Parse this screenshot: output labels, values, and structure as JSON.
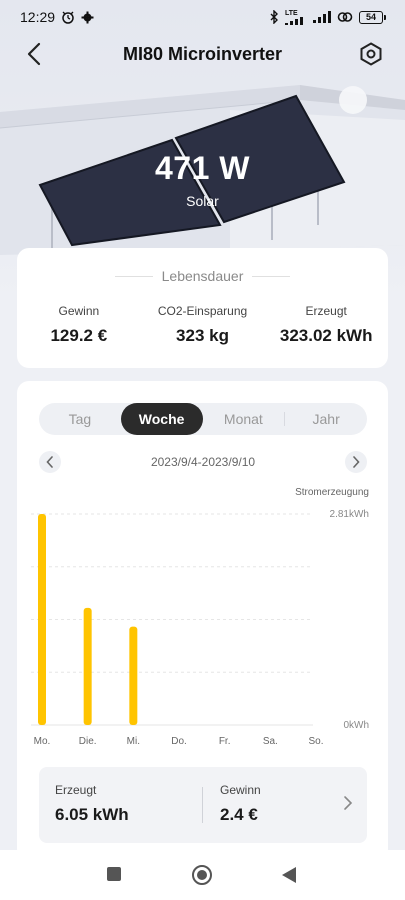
{
  "status_bar": {
    "time": "12:29",
    "left_icons": [
      "alarm-clock-icon",
      "gear-icon"
    ],
    "right_icons": [
      "bluetooth-icon",
      "lte-signal-icon",
      "signal-icon",
      "link-icon"
    ],
    "lte_label": "LTE",
    "battery": "54"
  },
  "header": {
    "title": "MI80 Microinverter",
    "back_icon": "back-arrow-icon",
    "settings_icon": "hexagon-settings-icon"
  },
  "hero": {
    "power_value": "471 W",
    "power_label": "Solar"
  },
  "lifetime": {
    "title": "Lebensdauer",
    "stats": [
      {
        "label": "Gewinn",
        "value": "129.2 €"
      },
      {
        "label": "CO2-Einsparung",
        "value": "323 kg"
      },
      {
        "label": "Erzeugt",
        "value": "323.02 kWh"
      }
    ]
  },
  "tabs": {
    "items": [
      "Tag",
      "Woche",
      "Monat",
      "Jahr"
    ],
    "active": "Woche"
  },
  "date_range": "2023/9/4-2023/9/10",
  "chart_data": {
    "type": "bar",
    "title": "Stromerzeugung",
    "categories": [
      "Mo.",
      "Die.",
      "Mi.",
      "Do.",
      "Fr.",
      "Sa.",
      "So."
    ],
    "values": [
      2.81,
      1.56,
      1.31,
      0,
      0,
      0,
      0
    ],
    "unit": "kWh",
    "y_max_label": "2.81kWh",
    "y_min_label": "0kWh",
    "ylim": [
      0,
      2.81
    ],
    "bar_color": "#ffc400",
    "grid": true
  },
  "summary": {
    "produced_label": "Erzeugt",
    "produced_value": "6.05 kWh",
    "profit_label": "Gewinn",
    "profit_value": "2.4 €"
  },
  "nav": {
    "icons": [
      "square-recent-icon",
      "circle-home-icon",
      "triangle-back-icon"
    ]
  },
  "colors": {
    "accent": "#ffc400",
    "active_tab": "#2b2b2b",
    "panel_dark": "#2c3044"
  }
}
